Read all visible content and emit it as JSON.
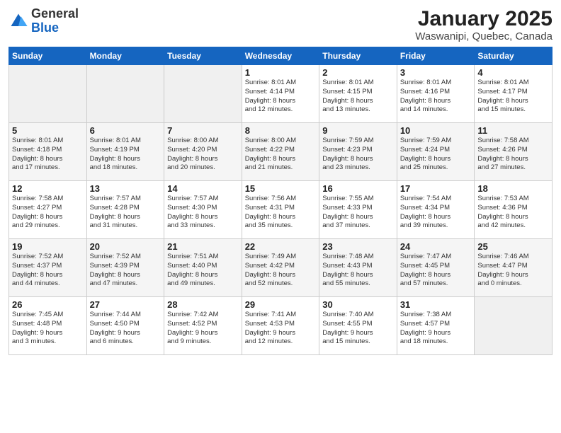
{
  "logo": {
    "general": "General",
    "blue": "Blue"
  },
  "calendar": {
    "title": "January 2025",
    "subtitle": "Waswanipi, Quebec, Canada",
    "headers": [
      "Sunday",
      "Monday",
      "Tuesday",
      "Wednesday",
      "Thursday",
      "Friday",
      "Saturday"
    ],
    "weeks": [
      [
        {
          "day": "",
          "empty": true
        },
        {
          "day": "",
          "empty": true
        },
        {
          "day": "",
          "empty": true
        },
        {
          "day": "1",
          "sunrise": "8:01 AM",
          "sunset": "4:14 PM",
          "daylight": "8 hours and 12 minutes."
        },
        {
          "day": "2",
          "sunrise": "8:01 AM",
          "sunset": "4:15 PM",
          "daylight": "8 hours and 13 minutes."
        },
        {
          "day": "3",
          "sunrise": "8:01 AM",
          "sunset": "4:16 PM",
          "daylight": "8 hours and 14 minutes."
        },
        {
          "day": "4",
          "sunrise": "8:01 AM",
          "sunset": "4:17 PM",
          "daylight": "8 hours and 15 minutes."
        }
      ],
      [
        {
          "day": "5",
          "sunrise": "8:01 AM",
          "sunset": "4:18 PM",
          "daylight": "8 hours and 17 minutes."
        },
        {
          "day": "6",
          "sunrise": "8:01 AM",
          "sunset": "4:19 PM",
          "daylight": "8 hours and 18 minutes."
        },
        {
          "day": "7",
          "sunrise": "8:00 AM",
          "sunset": "4:20 PM",
          "daylight": "8 hours and 20 minutes."
        },
        {
          "day": "8",
          "sunrise": "8:00 AM",
          "sunset": "4:22 PM",
          "daylight": "8 hours and 21 minutes."
        },
        {
          "day": "9",
          "sunrise": "7:59 AM",
          "sunset": "4:23 PM",
          "daylight": "8 hours and 23 minutes."
        },
        {
          "day": "10",
          "sunrise": "7:59 AM",
          "sunset": "4:24 PM",
          "daylight": "8 hours and 25 minutes."
        },
        {
          "day": "11",
          "sunrise": "7:58 AM",
          "sunset": "4:26 PM",
          "daylight": "8 hours and 27 minutes."
        }
      ],
      [
        {
          "day": "12",
          "sunrise": "7:58 AM",
          "sunset": "4:27 PM",
          "daylight": "8 hours and 29 minutes."
        },
        {
          "day": "13",
          "sunrise": "7:57 AM",
          "sunset": "4:28 PM",
          "daylight": "8 hours and 31 minutes."
        },
        {
          "day": "14",
          "sunrise": "7:57 AM",
          "sunset": "4:30 PM",
          "daylight": "8 hours and 33 minutes."
        },
        {
          "day": "15",
          "sunrise": "7:56 AM",
          "sunset": "4:31 PM",
          "daylight": "8 hours and 35 minutes."
        },
        {
          "day": "16",
          "sunrise": "7:55 AM",
          "sunset": "4:33 PM",
          "daylight": "8 hours and 37 minutes."
        },
        {
          "day": "17",
          "sunrise": "7:54 AM",
          "sunset": "4:34 PM",
          "daylight": "8 hours and 39 minutes."
        },
        {
          "day": "18",
          "sunrise": "7:53 AM",
          "sunset": "4:36 PM",
          "daylight": "8 hours and 42 minutes."
        }
      ],
      [
        {
          "day": "19",
          "sunrise": "7:52 AM",
          "sunset": "4:37 PM",
          "daylight": "8 hours and 44 minutes."
        },
        {
          "day": "20",
          "sunrise": "7:52 AM",
          "sunset": "4:39 PM",
          "daylight": "8 hours and 47 minutes."
        },
        {
          "day": "21",
          "sunrise": "7:51 AM",
          "sunset": "4:40 PM",
          "daylight": "8 hours and 49 minutes."
        },
        {
          "day": "22",
          "sunrise": "7:49 AM",
          "sunset": "4:42 PM",
          "daylight": "8 hours and 52 minutes."
        },
        {
          "day": "23",
          "sunrise": "7:48 AM",
          "sunset": "4:43 PM",
          "daylight": "8 hours and 55 minutes."
        },
        {
          "day": "24",
          "sunrise": "7:47 AM",
          "sunset": "4:45 PM",
          "daylight": "8 hours and 57 minutes."
        },
        {
          "day": "25",
          "sunrise": "7:46 AM",
          "sunset": "4:47 PM",
          "daylight": "9 hours and 0 minutes."
        }
      ],
      [
        {
          "day": "26",
          "sunrise": "7:45 AM",
          "sunset": "4:48 PM",
          "daylight": "9 hours and 3 minutes."
        },
        {
          "day": "27",
          "sunrise": "7:44 AM",
          "sunset": "4:50 PM",
          "daylight": "9 hours and 6 minutes."
        },
        {
          "day": "28",
          "sunrise": "7:42 AM",
          "sunset": "4:52 PM",
          "daylight": "9 hours and 9 minutes."
        },
        {
          "day": "29",
          "sunrise": "7:41 AM",
          "sunset": "4:53 PM",
          "daylight": "9 hours and 12 minutes."
        },
        {
          "day": "30",
          "sunrise": "7:40 AM",
          "sunset": "4:55 PM",
          "daylight": "9 hours and 15 minutes."
        },
        {
          "day": "31",
          "sunrise": "7:38 AM",
          "sunset": "4:57 PM",
          "daylight": "9 hours and 18 minutes."
        },
        {
          "day": "",
          "empty": true
        }
      ]
    ]
  }
}
